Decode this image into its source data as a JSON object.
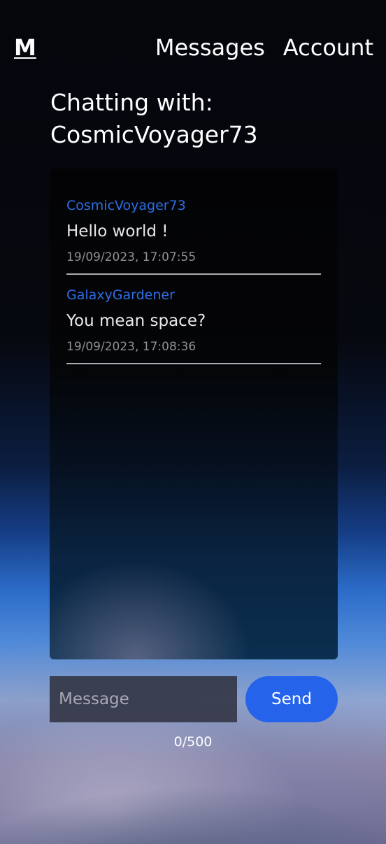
{
  "nav": {
    "logo": "M",
    "links": [
      "Messages",
      "Account"
    ]
  },
  "chat": {
    "title_prefix": "Chatting with:",
    "partner": "CosmicVoyager73",
    "messages": [
      {
        "sender": "CosmicVoyager73",
        "text": "Hello world !",
        "timestamp": "19/09/2023, 17:07:55"
      },
      {
        "sender": "GalaxyGardener",
        "text": "You mean space?",
        "timestamp": "19/09/2023, 17:08:36"
      }
    ]
  },
  "composer": {
    "placeholder": "Message",
    "value": "",
    "send_label": "Send",
    "char_count": "0/500"
  },
  "colors": {
    "accent": "#2563eb",
    "sender_name": "#2f6fe4"
  }
}
